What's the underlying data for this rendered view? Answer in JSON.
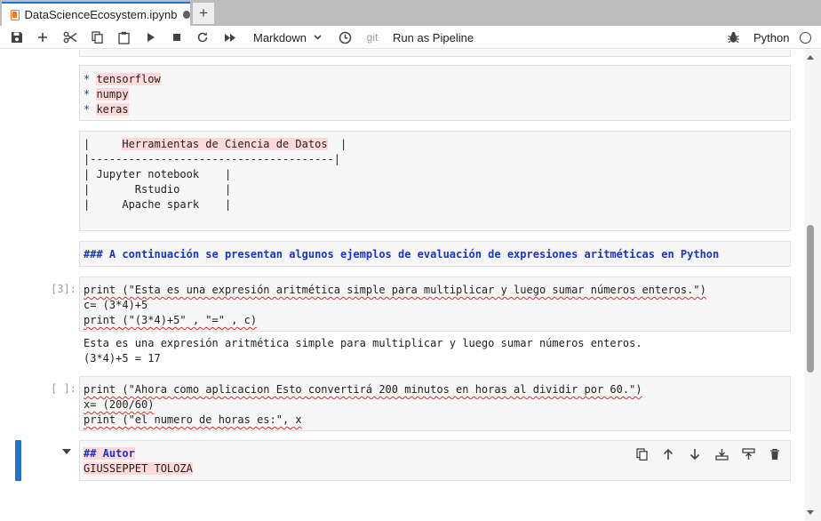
{
  "tab": {
    "title": "DataScienceEcosystem.ipynb",
    "new_tab_label": "+",
    "icon": "notebook-icon"
  },
  "toolbar": {
    "cell_type": "Markdown",
    "git_label": "git",
    "pipeline_label": "Run as Pipeline",
    "kernel_name": "Python",
    "icons": [
      "save-icon",
      "add-cell-icon",
      "cut-icon",
      "copy-icon",
      "paste-icon",
      "run-icon",
      "stop-icon",
      "restart-icon",
      "fast-forward-icon",
      "clock-icon",
      "bug-icon"
    ]
  },
  "cells": {
    "list_cell": {
      "items": [
        "tensorflow",
        "numpy",
        "keras"
      ]
    },
    "table_cell": {
      "header": "Herramientas de Ciencia de Datos",
      "separator": "|--------------------------------------|",
      "rows": [
        "| Jupyter notebook    |",
        "|       Rstudio       |",
        "|     Apache spark    |"
      ]
    },
    "heading_cell": {
      "text": "### A continuación se presentan algunos ejemplos de evaluación de expresiones aritméticas en Python"
    },
    "code_cell_1": {
      "prompt": "[3]:",
      "lines": [
        "print (\"Esta es una expresión aritmética simple para multiplicar y luego sumar números enteros.\")",
        "c= (3*4)+5",
        "print (\"(3*4)+5\" , \"=\" , c)"
      ],
      "output": [
        "Esta es una expresión aritmética simple para multiplicar y luego sumar números enteros.",
        "(3*4)+5 = 17"
      ]
    },
    "code_cell_2": {
      "prompt": "[ ]:",
      "lines": [
        "print (\"Ahora como aplicacion Esto convertirá 200 minutos en horas al dividir por 60.\")",
        "x= (200/60)",
        "print (\"el numero de horas es:\", x"
      ]
    },
    "author_cell": {
      "heading": "## Autor",
      "name": "GIUSSEPPET TOLOZA"
    }
  },
  "colors": {
    "accent": "#1976d2",
    "notebook_orange": "#f37726",
    "highlight": "#ffd9d9",
    "heading_blue": "#1a33c8"
  }
}
